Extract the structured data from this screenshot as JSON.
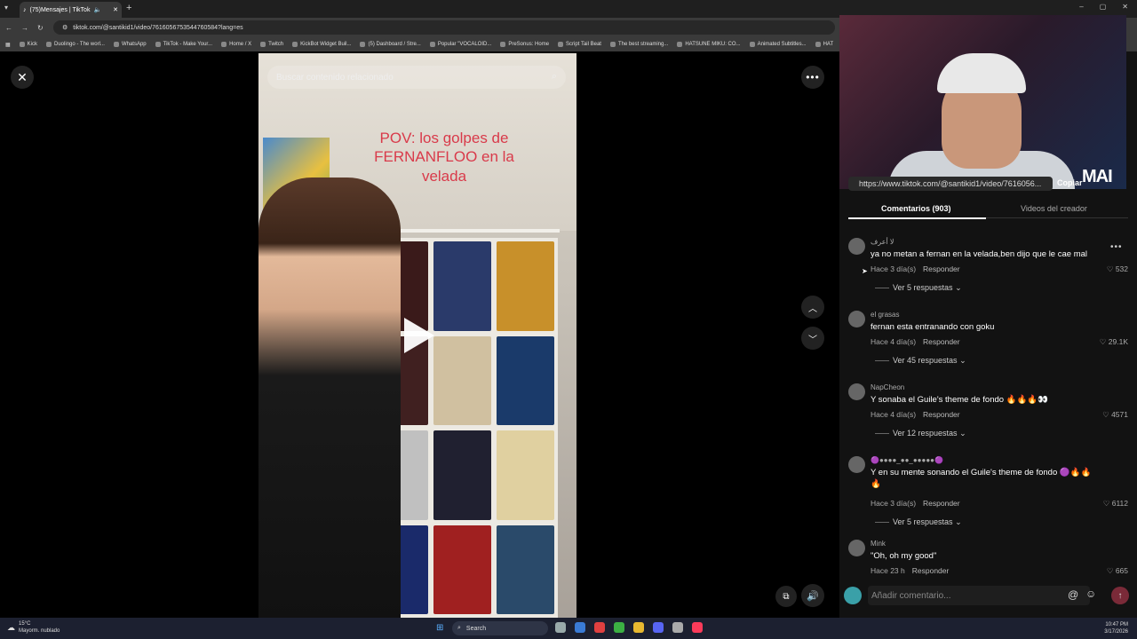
{
  "browser": {
    "tab_title": "(75)Mensajes | TikTok",
    "url": "tiktok.com/@santikid1/video/7616056753544760584?lang=es",
    "bookmarks": [
      "Kick",
      "Duolingo - The worl...",
      "WhatsApp",
      "TikTok - Make Your...",
      "Home / X",
      "Twitch",
      "KickBot Widget Buil...",
      "(5) Dashboard / Stre...",
      "Popular \"VOCALOID...",
      "PreSonus: Home",
      "Script Tail Beat",
      "The best streaming...",
      "HATSUNE MIKU: CO...",
      "Animated Subtitles...",
      "HAT"
    ]
  },
  "video": {
    "search_placeholder": "Buscar contenido relacionado",
    "overlay_text": "POV: los golpes de FERNANFLOO en la velada"
  },
  "webcam": {
    "logo": "MAI"
  },
  "share": {
    "url": "https://www.tiktok.com/@santikid1/video/7616056...",
    "copy_label": "Copiar"
  },
  "comments_tabs": {
    "comments": "Comentarios (903)",
    "creator_videos": "Videos del creador"
  },
  "comments": [
    {
      "user": "لا أعرف",
      "text": "ya no metan a fernan en la velada,ben dijo que le cae mal",
      "time": "Hace 3 día(s)",
      "reply": "Responder",
      "likes": "532",
      "replies": "Ver 5 respuestas"
    },
    {
      "user": "el grasas",
      "text": "fernan esta entranando con goku",
      "time": "Hace 4 día(s)",
      "reply": "Responder",
      "likes": "29.1K",
      "replies": "Ver 45 respuestas"
    },
    {
      "user": "NapCheon",
      "text": "Y sonaba el Guile's theme de fondo 🔥🔥🔥👀",
      "time": "Hace 4 día(s)",
      "reply": "Responder",
      "likes": "4571",
      "replies": "Ver 12 respuestas"
    },
    {
      "user": "🟣●●●●_●●_●●●●●🟣",
      "text": "Y en su mente sonando el Guile's theme de fondo 🟣🔥🔥🔥",
      "time": "Hace 3 día(s)",
      "reply": "Responder",
      "likes": "6112",
      "replies": "Ver 5 respuestas"
    },
    {
      "user": "Mink",
      "text": "\"Oh, oh my good\"",
      "time": "Hace 23 h",
      "reply": "Responder",
      "likes": "665",
      "replies": ""
    }
  ],
  "add_comment": {
    "placeholder": "Añadir comentario..."
  },
  "taskbar": {
    "temp": "15°C",
    "weather": "Mayorm. nublado",
    "search": "Search",
    "time": "10:47 PM",
    "date": "3/17/2026"
  }
}
